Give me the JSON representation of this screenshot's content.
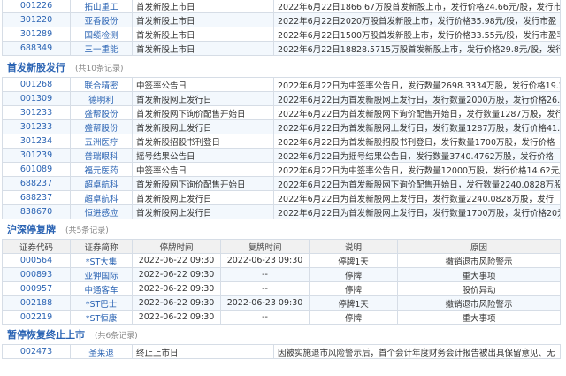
{
  "top_rows": [
    [
      "001226",
      "拓山重工",
      "首发新股上市日",
      "2022年6月22日1866.67万股首发新股上市，发行价格24.66元/股，发行市"
    ],
    [
      "301220",
      "亚香股份",
      "首发新股上市日",
      "2022年6月22日2020万股首发新股上市，发行价格35.98元/股，发行市盈"
    ],
    [
      "301289",
      "国缆检测",
      "首发新股上市日",
      "2022年6月22日1500万股首发新股上市，发行价格33.55元/股，发行市盈率"
    ],
    [
      "688349",
      "三一重能",
      "首发新股上市日",
      "2022年6月22日18828.5715万股首发新股上市，发行价格29.8元/股，发行市"
    ]
  ],
  "ipo": {
    "title": "首发新股发行",
    "count": "(共10条记录)",
    "rows": [
      [
        "001268",
        "联合精密",
        "中签率公告日",
        "2022年6月22日为中签率公告日，发行数量2698.3334万股，发行价格19.2"
      ],
      [
        "001309",
        "德明利",
        "首发新股网上发行日",
        "2022年6月22日为首发新股网上发行日，发行数量2000万股，发行价格26.5"
      ],
      [
        "301233",
        "盛帮股份",
        "首发新股网下询价配售开始日",
        "2022年6月22日为首发新股网下询价配售开始日，发行数量1287万股，发行"
      ],
      [
        "301233",
        "盛帮股份",
        "首发新股网上发行日",
        "2022年6月22日为首发新股网上发行日，发行数量1287万股，发行价格41.5"
      ],
      [
        "301234",
        "五洲医疗",
        "首发新股招股书刊登日",
        "2022年6月22日为首发新股招股书刊登日，发行数量1700万股，发行价格"
      ],
      [
        "301239",
        "普瑞眼科",
        "摇号结果公告日",
        "2022年6月22日为摇号结果公告日，发行数量3740.4762万股，发行价格"
      ],
      [
        "601089",
        "福元医药",
        "中签率公告日",
        "2022年6月22日为中签率公告日，发行数量12000万股，发行价格14.62元/"
      ],
      [
        "688237",
        "超卓航科",
        "首发新股网下询价配售开始日",
        "2022年6月22日为首发新股网下询价配售开始日，发行数量2240.0828万股，"
      ],
      [
        "688237",
        "超卓航科",
        "首发新股网上发行日",
        "2022年6月22日为首发新股网上发行日，发行数量2240.0828万股，发行"
      ],
      [
        "838670",
        "恒进感应",
        "首发新股网上发行日",
        "2022年6月22日为首发新股网上发行日，发行数量1700万股，发行价格20元"
      ]
    ]
  },
  "halt": {
    "title": "沪深停复牌",
    "count": "(共5条记录)",
    "headers": [
      "证券代码",
      "证券简称",
      "停牌时间",
      "复牌时间",
      "说明",
      "原因"
    ],
    "rows": [
      [
        "000564",
        "*ST大集",
        "2022-06-22 09:30",
        "2022-06-23 09:30",
        "停牌1天",
        "撤销退市风险警示"
      ],
      [
        "000893",
        "亚钾国际",
        "2022-06-22 09:30",
        "--",
        "停牌",
        "重大事项"
      ],
      [
        "000957",
        "中通客车",
        "2022-06-22 09:30",
        "--",
        "停牌",
        "股价异动"
      ],
      [
        "002188",
        "*ST巴士",
        "2022-06-22 09:30",
        "2022-06-23 09:30",
        "停牌1天",
        "撤销退市风险警示"
      ],
      [
        "002219",
        "*ST恒康",
        "2022-06-22 09:30",
        "--",
        "停牌",
        "重大事项"
      ]
    ]
  },
  "suspend": {
    "title": "暂停恢复终止上市",
    "count": "(共6条记录)",
    "rows": [
      [
        "002473",
        "圣莱退",
        "终止上市日",
        "因被实施退市风险警示后，首个会计年度财务会计报告被出具保留意见、无"
      ]
    ]
  }
}
